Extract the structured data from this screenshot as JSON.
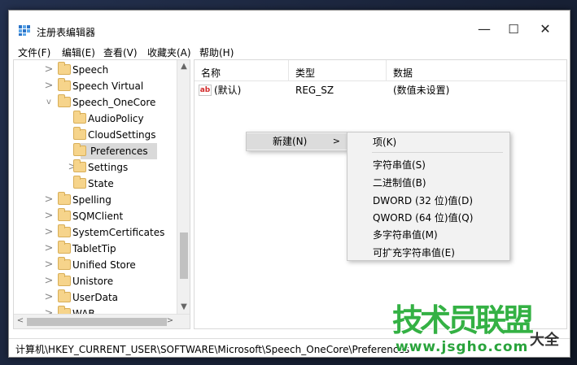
{
  "window": {
    "title": "注册表编辑器",
    "controls": {
      "minimize": "—",
      "maximize": "☐",
      "close": "✕"
    }
  },
  "menu": [
    "文件(F)",
    "编辑(E)",
    "查看(V)",
    "收藏夹(A)",
    "帮助(H)"
  ],
  "tree": {
    "items": [
      {
        "label": "Speech",
        "expander": ">"
      },
      {
        "label": "Speech Virtual",
        "expander": ">"
      },
      {
        "label": "Speech_OneCore",
        "expander": "v"
      },
      {
        "label": "AudioPolicy",
        "expander": ""
      },
      {
        "label": "CloudSettings",
        "expander": ""
      },
      {
        "label": "Preferences",
        "expander": ""
      },
      {
        "label": "Settings",
        "expander": ">"
      },
      {
        "label": "State",
        "expander": ""
      },
      {
        "label": "Spelling",
        "expander": ">"
      },
      {
        "label": "SQMClient",
        "expander": ">"
      },
      {
        "label": "SystemCertificates",
        "expander": ">"
      },
      {
        "label": "TabletTip",
        "expander": ">"
      },
      {
        "label": "Unified Store",
        "expander": ">"
      },
      {
        "label": "Unistore",
        "expander": ">"
      },
      {
        "label": "UserData",
        "expander": ">"
      },
      {
        "label": "WAB",
        "expander": ">"
      }
    ],
    "scroll": {
      "up": "▲",
      "down": "▼",
      "left": "<",
      "right": ">"
    }
  },
  "list": {
    "headers": {
      "name": "名称",
      "type": "类型",
      "data": "数据"
    },
    "rows": [
      {
        "icon": "ab",
        "name": "(默认)",
        "type": "REG_SZ",
        "data": "(数值未设置)"
      }
    ]
  },
  "context_menu": {
    "new": "新建(N)",
    "arrow": ">",
    "submenu": [
      "项(K)",
      "字符串值(S)",
      "二进制值(B)",
      "DWORD (32 位)值(D)",
      "QWORD (64 位)值(Q)",
      "多字符串值(M)",
      "可扩充字符串值(E)"
    ]
  },
  "status": {
    "path": "计算机\\HKEY_CURRENT_USER\\SOFTWARE\\Microsoft\\Speech_OneCore\\Preferences"
  },
  "watermark": {
    "main": "技术员联盟",
    "side": "大全",
    "url": "www.jsgho.com"
  }
}
